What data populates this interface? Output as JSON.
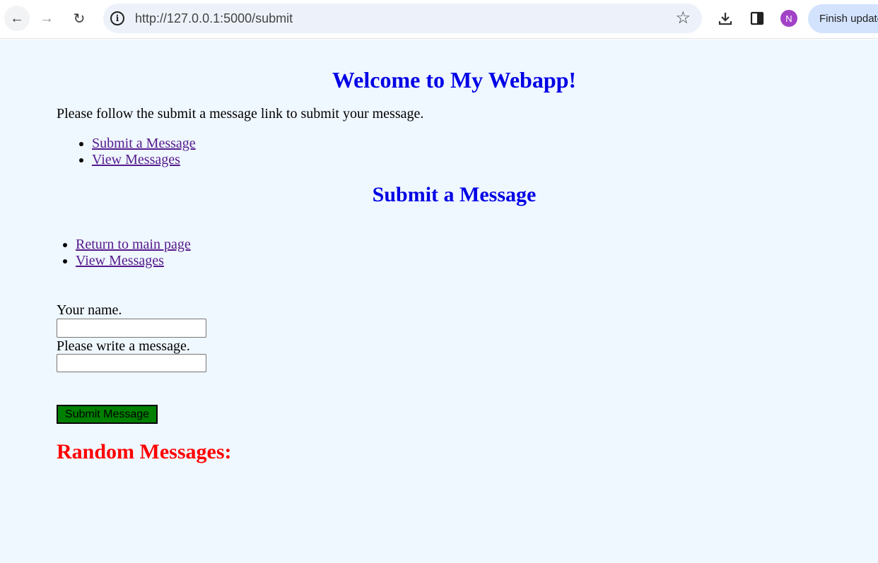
{
  "browser": {
    "url": "http://127.0.0.1:5000/submit",
    "avatar_initial": "N",
    "finish_update_label": "Finish update",
    "back_glyph": "←",
    "forward_glyph": "→",
    "reload_glyph": "↻",
    "star_glyph": "☆"
  },
  "page": {
    "welcome_heading": "Welcome to My Webapp!",
    "intro_text": "Please follow the submit a message link to submit your message.",
    "nav_links": [
      "Submit a Message",
      "View Messages"
    ],
    "submit_heading": "Submit a Message",
    "secondary_links": [
      "Return to main page",
      "View Messages"
    ],
    "name_label": "Your name.",
    "name_value": "",
    "message_label": "Please write a message.",
    "message_value": "",
    "submit_button_label": "Submit Message",
    "random_heading": "Random Messages:"
  },
  "colors": {
    "page_background": "#eff7ff",
    "heading_blue": "#0000e6",
    "random_heading_red": "#ff0000",
    "submit_button_green": "#008000",
    "link_visited": "#551a8b"
  }
}
